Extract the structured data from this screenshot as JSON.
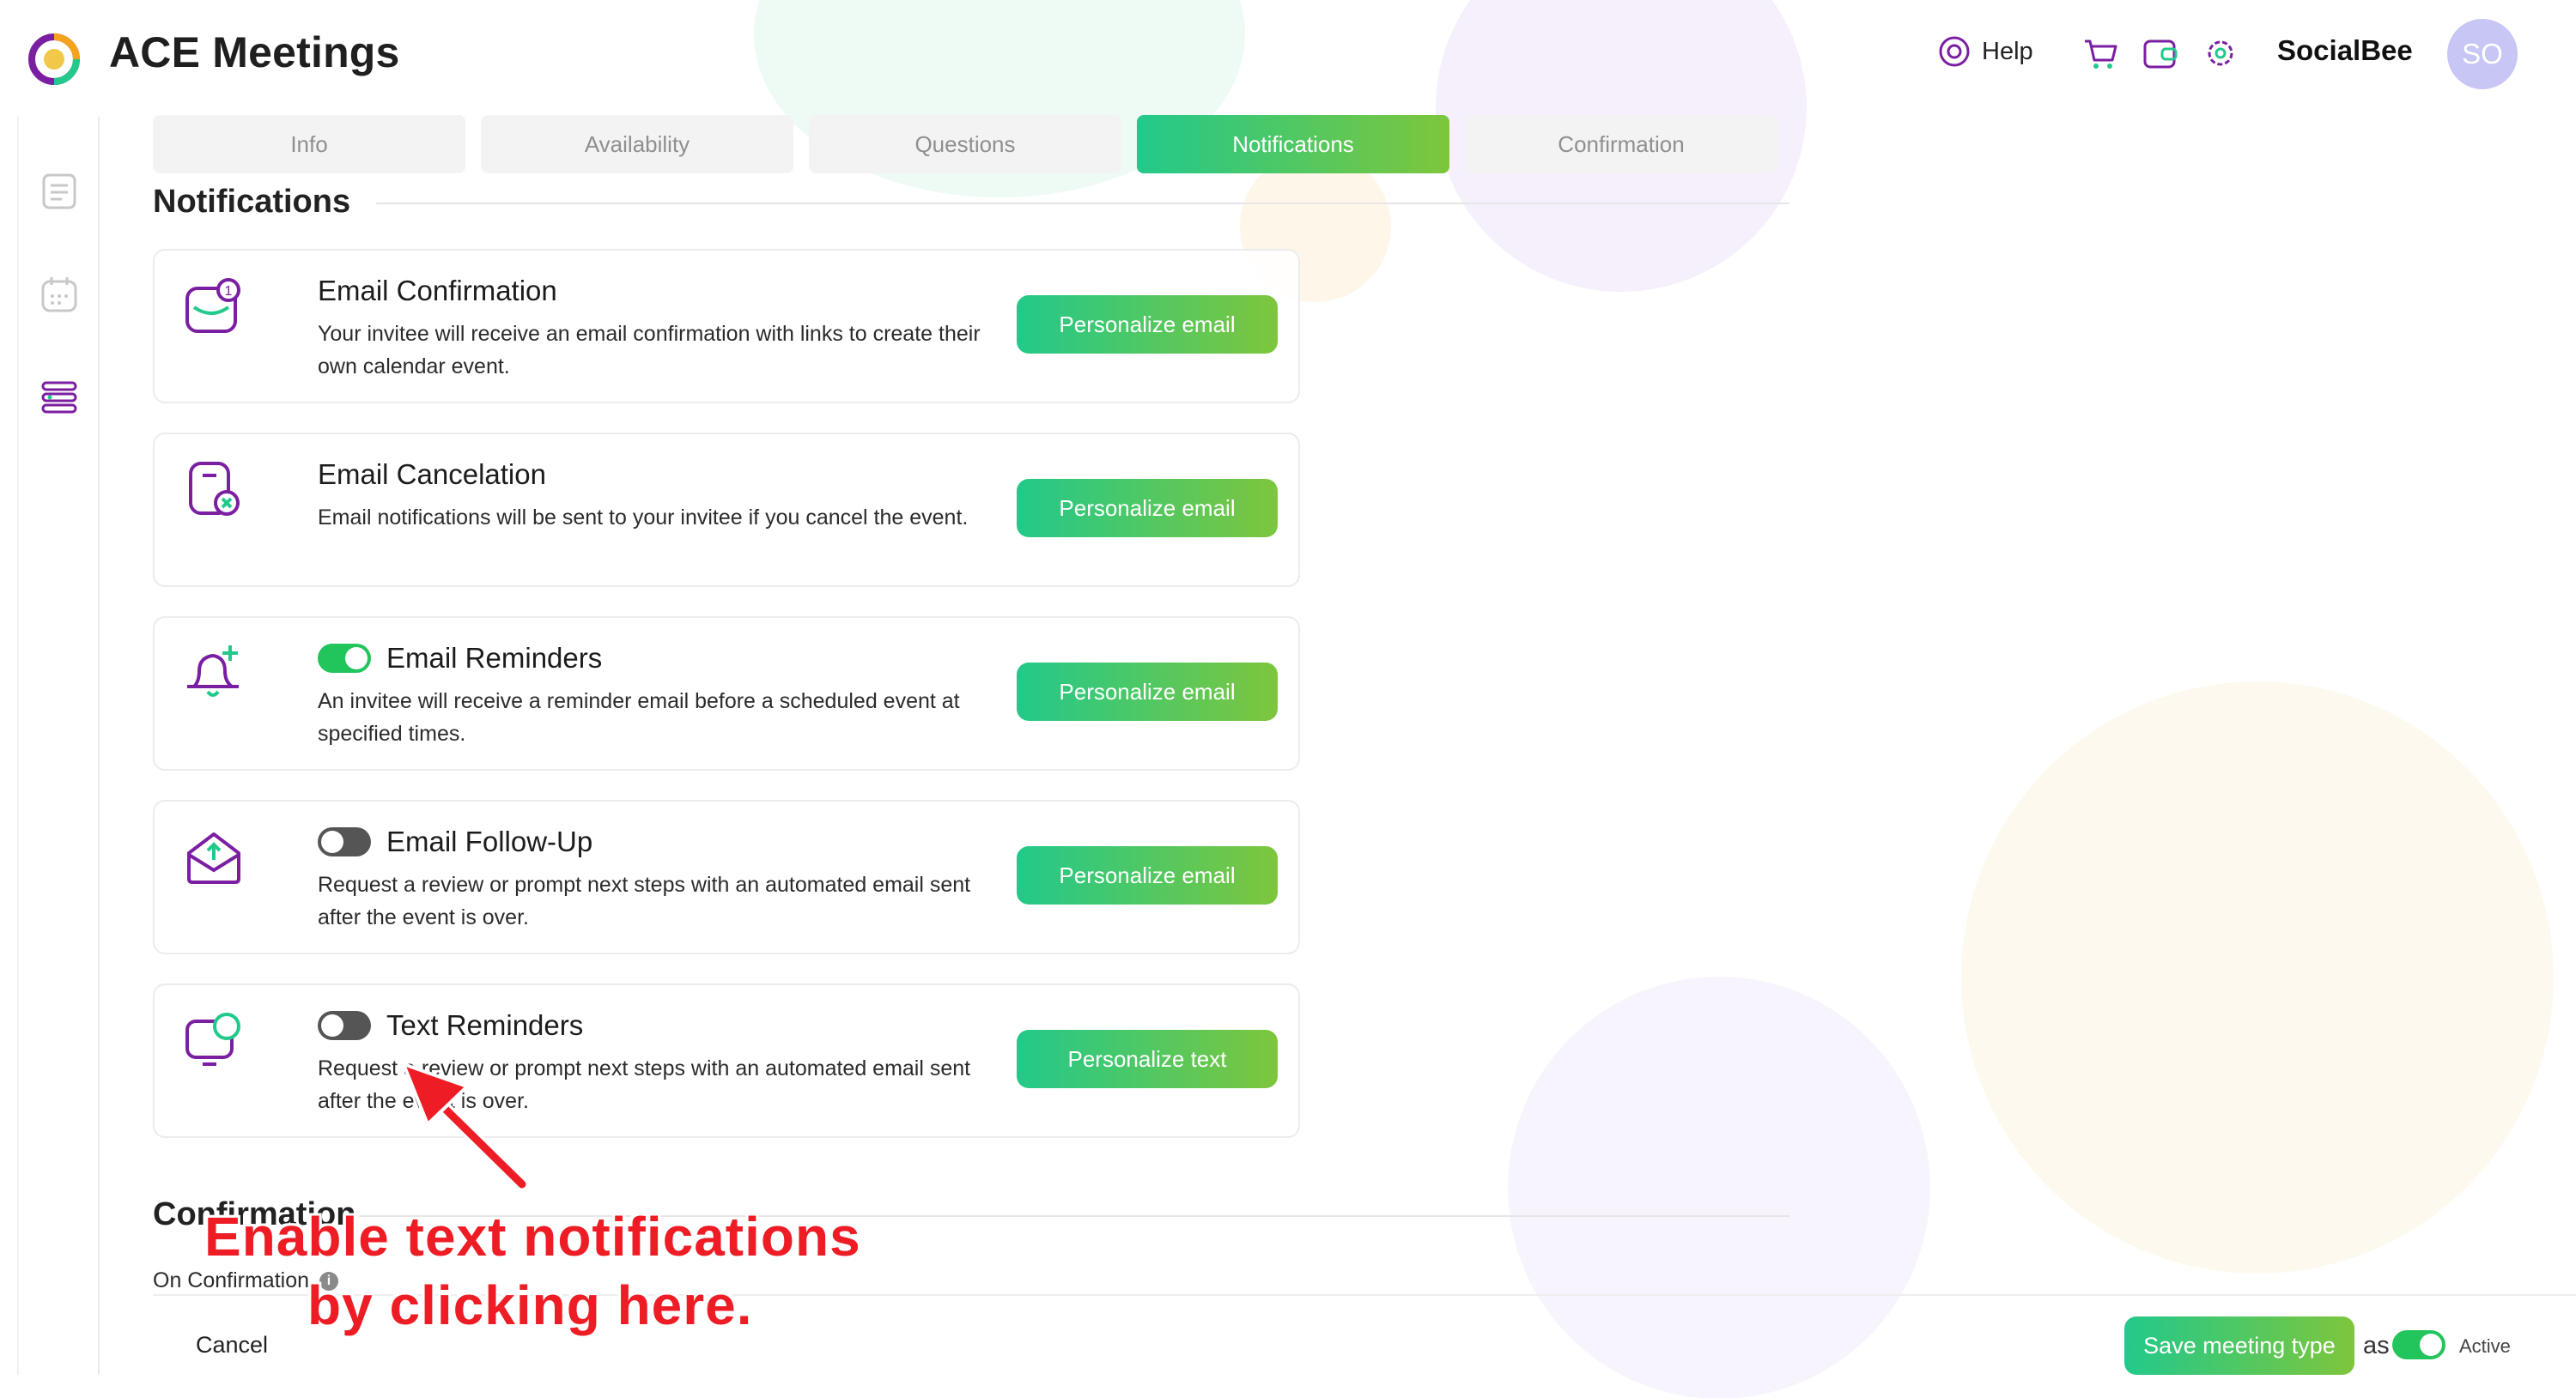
{
  "header": {
    "app_title": "ACE Meetings",
    "help_label": "Help",
    "user_name": "SocialBee",
    "avatar_initials": "SO"
  },
  "tabs": [
    {
      "label": "Info",
      "active": false
    },
    {
      "label": "Availability",
      "active": false
    },
    {
      "label": "Questions",
      "active": false
    },
    {
      "label": "Notifications",
      "active": true
    },
    {
      "label": "Confirmation",
      "active": false
    }
  ],
  "notifications": {
    "heading": "Notifications",
    "cards": [
      {
        "title": "Email Confirmation",
        "description": "Your invitee will receive an email confirmation with links to create their own calendar event.",
        "button": "Personalize email",
        "toggle": null,
        "icon": "email-confirmation-icon"
      },
      {
        "title": "Email Cancelation",
        "description": "Email notifications will be sent to your invitee if you cancel the event.",
        "button": "Personalize email",
        "toggle": null,
        "icon": "email-cancel-icon"
      },
      {
        "title": "Email Reminders",
        "description": "An invitee will receive a reminder email before a scheduled event at specified times.",
        "button": "Personalize email",
        "toggle": "on",
        "icon": "bell-plus-icon"
      },
      {
        "title": "Email Follow-Up",
        "description": "Request a review or prompt next steps with an automated email sent after the event is over.",
        "button": "Personalize email",
        "toggle": "off",
        "icon": "envelope-open-icon"
      },
      {
        "title": "Text Reminders",
        "description": "Request a review or prompt next steps with an automated email sent after the event is over.",
        "button": "Personalize text",
        "toggle": "off",
        "icon": "chat-screen-icon"
      }
    ]
  },
  "confirmation": {
    "heading": "Confirmation",
    "on_confirmation_label": "On Confirmation"
  },
  "footer": {
    "cancel_label": "Cancel",
    "save_label": "Save meeting type",
    "as_label": "as",
    "active_label": "Active"
  },
  "annotation": {
    "line1": "Enable text notifications",
    "line2": "by clicking here."
  },
  "colors": {
    "accent_start": "#22c98b",
    "accent_end": "#7ec63c",
    "icon_purple": "#7b1fa2",
    "annotation_red": "#ee1c24"
  }
}
